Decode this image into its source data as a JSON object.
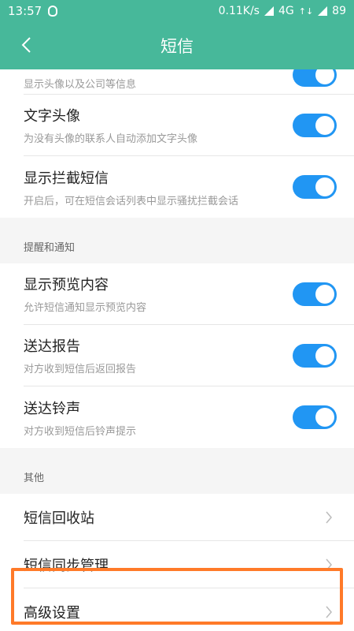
{
  "status_bar": {
    "time": "13:57",
    "network_speed": "0.11K/s",
    "network_type": "4G",
    "battery": "89"
  },
  "header": {
    "title": "短信"
  },
  "sections": [
    {
      "items": [
        {
          "title": "",
          "subtitle": "显示头像以及公司等信息",
          "toggle": true,
          "partial": true
        },
        {
          "title": "文字头像",
          "subtitle": "为没有头像的联系人自动添加文字头像",
          "toggle": true
        },
        {
          "title": "显示拦截短信",
          "subtitle": "开启后，可在短信会话列表中显示骚扰拦截会话",
          "toggle": true
        }
      ]
    },
    {
      "heading": "提醒和通知",
      "items": [
        {
          "title": "显示预览内容",
          "subtitle": "允许短信通知显示预览内容",
          "toggle": true
        },
        {
          "title": "送达报告",
          "subtitle": "对方收到短信后返回报告",
          "toggle": true
        },
        {
          "title": "送达铃声",
          "subtitle": "对方收到短信后铃声提示",
          "toggle": true
        }
      ]
    },
    {
      "heading": "其他",
      "items": [
        {
          "title": "短信回收站"
        },
        {
          "title": "短信同步管理"
        },
        {
          "title": "高级设置"
        }
      ]
    }
  ],
  "colors": {
    "accent": "#47b89a",
    "toggle_on": "#2196f3",
    "highlight": "#ff7a29"
  },
  "icons": {
    "back": "chevron-left-icon",
    "row_arrow": "chevron-right-icon"
  }
}
